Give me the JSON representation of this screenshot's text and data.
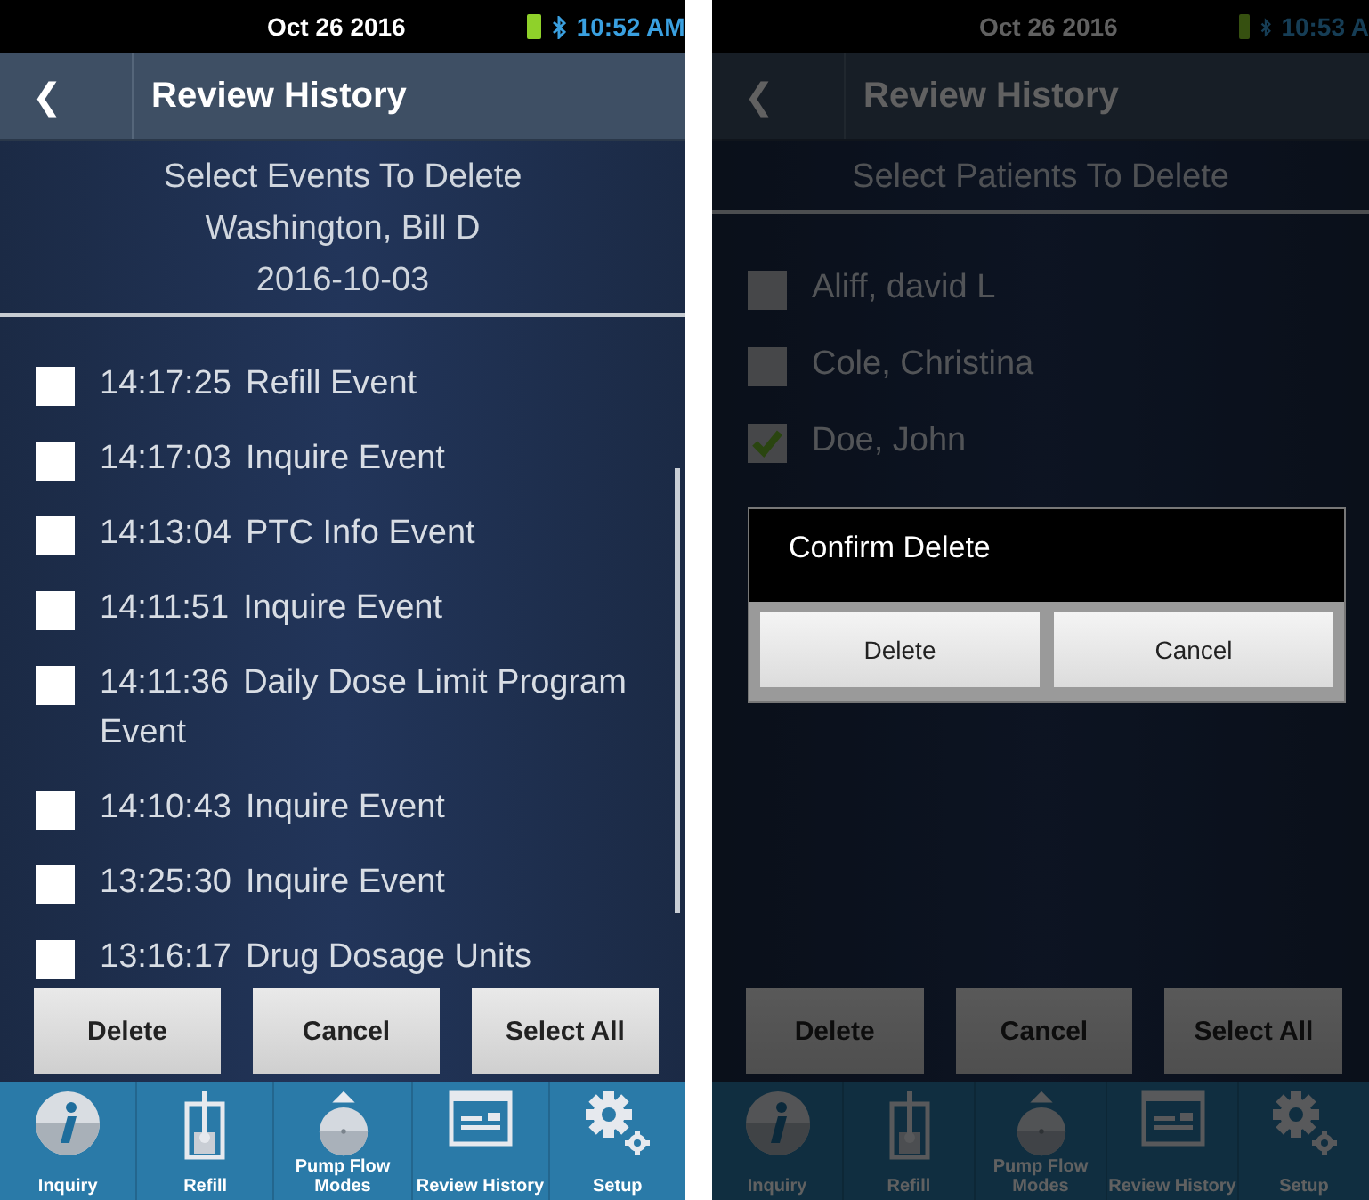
{
  "screens": [
    {
      "status_bar": {
        "date": "Oct 26 2016",
        "time": "10:52 AM"
      },
      "header": {
        "back": "❮",
        "title": "Review History"
      },
      "subtitle": [
        "Select Events To Delete",
        "Washington, Bill D",
        "2016-10-03"
      ],
      "items": [
        {
          "time": "14:17:25",
          "label": "Refill Event",
          "checked": false
        },
        {
          "time": "14:17:03",
          "label": "Inquire Event",
          "checked": false
        },
        {
          "time": "14:13:04",
          "label": "PTC Info Event",
          "checked": false
        },
        {
          "time": "14:11:51",
          "label": "Inquire Event",
          "checked": false
        },
        {
          "time": "14:11:36",
          "label": "Daily Dose Limit Program Event",
          "checked": false
        },
        {
          "time": "14:10:43",
          "label": "Inquire Event",
          "checked": false
        },
        {
          "time": "13:25:30",
          "label": "Inquire Event",
          "checked": false
        },
        {
          "time": "13:16:17",
          "label": "Drug Dosage Units",
          "checked": false
        }
      ],
      "buttons": [
        "Delete",
        "Cancel",
        "Select All"
      ],
      "nav": [
        "Inquiry",
        "Refill",
        "Pump Flow Modes",
        "Review History",
        "Setup"
      ]
    },
    {
      "status_bar": {
        "date": "Oct 26 2016",
        "time": "10:53 A"
      },
      "header": {
        "back": "❮",
        "title": "Review History"
      },
      "subtitle": [
        "Select Patients To Delete"
      ],
      "dimmed": true,
      "items": [
        {
          "label": "Aliff, david L",
          "checked": false
        },
        {
          "label": "Cole, Christina",
          "checked": false
        },
        {
          "label": "Doe, John",
          "checked": true
        }
      ],
      "buttons": [
        "Delete",
        "Cancel",
        "Select All"
      ],
      "nav": [
        "Inquiry",
        "Refill",
        "Pump Flow Modes",
        "Review History",
        "Setup"
      ],
      "dialog": {
        "title": "Confirm Delete",
        "buttons": [
          "Delete",
          "Cancel"
        ]
      }
    }
  ]
}
